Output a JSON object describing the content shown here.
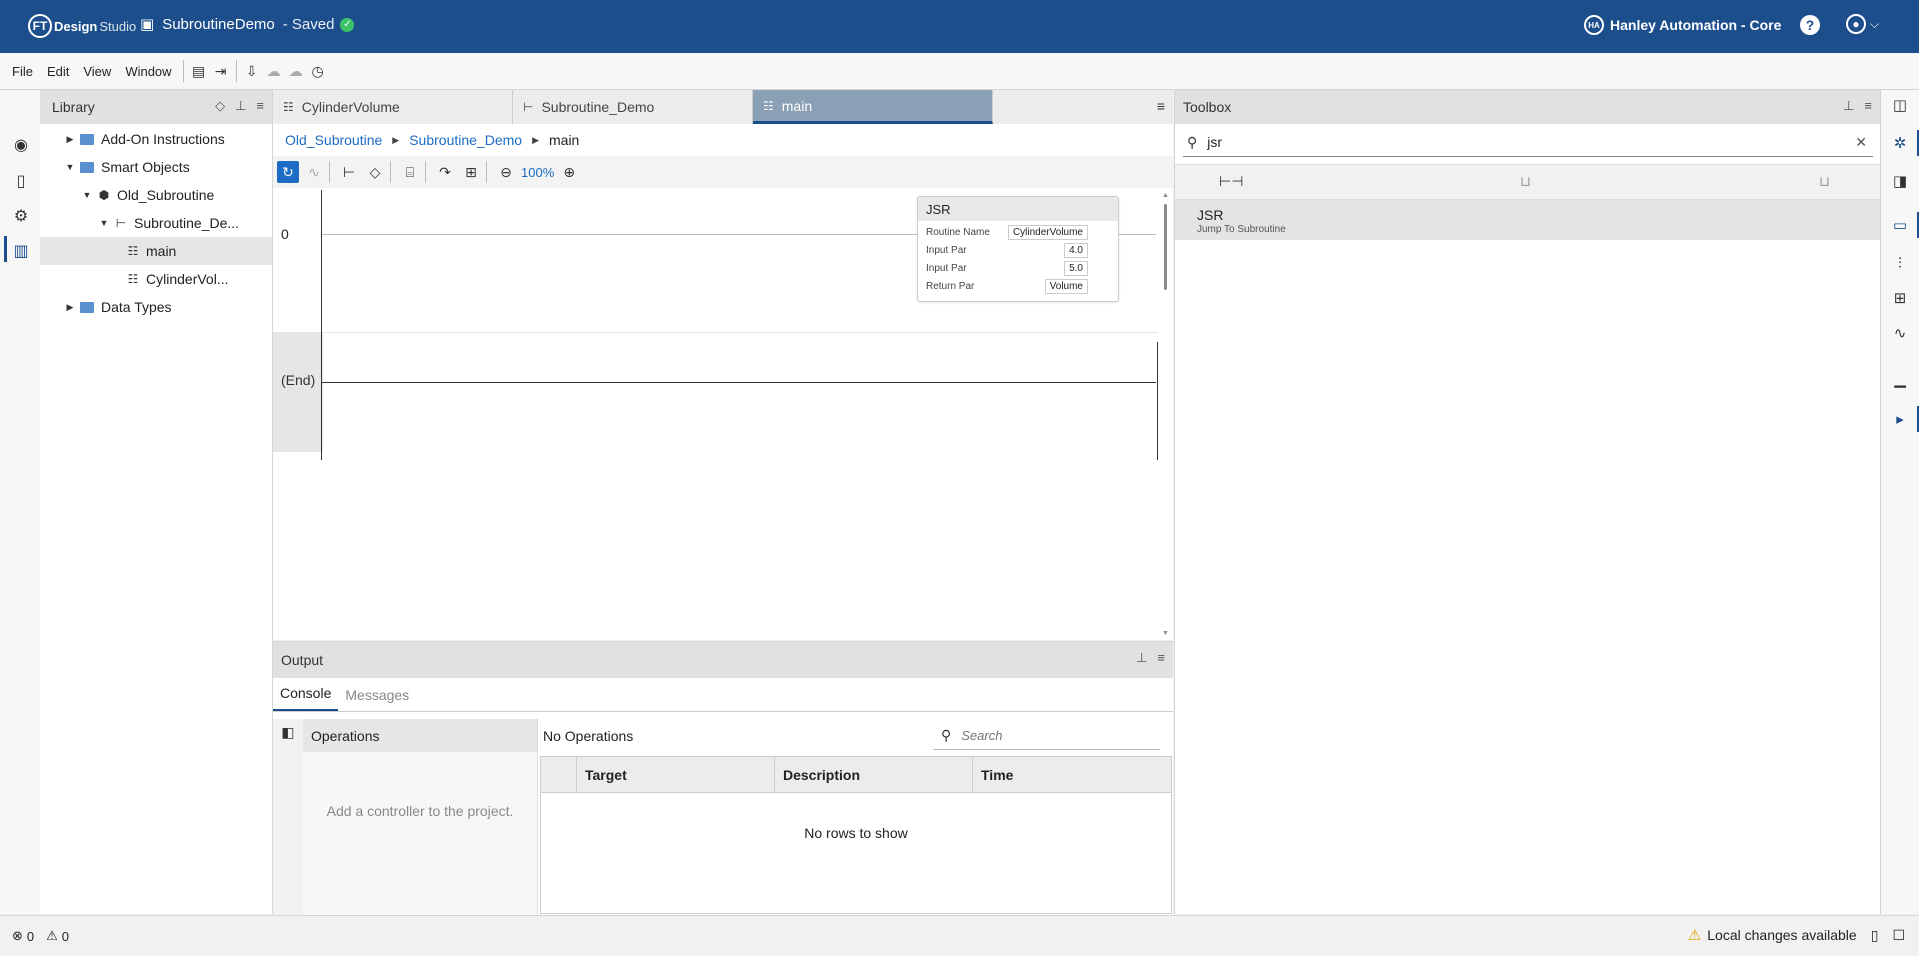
{
  "header": {
    "logo_ft": "FT",
    "logo_brand1": "Design",
    "logo_brand2": "Studio",
    "project_name": "SubroutineDemo",
    "project_status": "- Saved",
    "organization": "Hanley Automation - Core",
    "help": "?",
    "colors": {
      "bar": "#1c4e8c",
      "saved_check": "#3cc36a"
    }
  },
  "menu": [
    "File",
    "Edit",
    "View",
    "Window"
  ],
  "library": {
    "title": "Library",
    "tree": [
      {
        "label": "Add-On Instructions",
        "level": 1,
        "type": "folder",
        "expanded": false
      },
      {
        "label": "Smart Objects",
        "level": 1,
        "type": "folder",
        "expanded": true
      },
      {
        "label": "Old_Subroutine",
        "level": 2,
        "type": "object",
        "expanded": true
      },
      {
        "label": "Subroutine_De...",
        "level": 3,
        "type": "program",
        "expanded": true
      },
      {
        "label": "main",
        "level": 4,
        "type": "routine",
        "selected": true
      },
      {
        "label": "CylinderVol...",
        "level": 4,
        "type": "routine"
      },
      {
        "label": "Data Types",
        "level": 1,
        "type": "folder",
        "expanded": false
      }
    ]
  },
  "editor": {
    "tabs": [
      {
        "label": "CylinderVolume",
        "active": false
      },
      {
        "label": "Subroutine_Demo",
        "active": false
      },
      {
        "label": "main",
        "active": true
      }
    ],
    "breadcrumb": [
      "Old_Subroutine",
      "Subroutine_Demo",
      "main"
    ],
    "zoom": "100%",
    "rungs": {
      "first": "0",
      "end": "(End)"
    },
    "jsr": {
      "title": "JSR",
      "rows": [
        {
          "label": "Routine Name",
          "value": "CylinderVolume"
        },
        {
          "label": "Input Par",
          "value": "4.0"
        },
        {
          "label": "Input Par",
          "value": "5.0"
        },
        {
          "label": "Return Par",
          "value": "Volume"
        }
      ]
    }
  },
  "output": {
    "title": "Output",
    "tabs": [
      {
        "label": "Console",
        "active": true
      },
      {
        "label": "Messages",
        "active": false
      }
    ],
    "operations_title": "Operations",
    "operations_empty": "Add a controller to the project.",
    "no_operations": "No Operations",
    "search_placeholder": "Search",
    "columns": [
      "Target",
      "Description",
      "Time"
    ],
    "empty_rows": "No rows to show"
  },
  "toolbox": {
    "title": "Toolbox",
    "search_value": "jsr",
    "results": [
      {
        "name": "JSR",
        "description": "Jump To Subroutine"
      }
    ]
  },
  "status": {
    "errors": "0",
    "warnings": "0",
    "local_changes": "Local changes available"
  }
}
